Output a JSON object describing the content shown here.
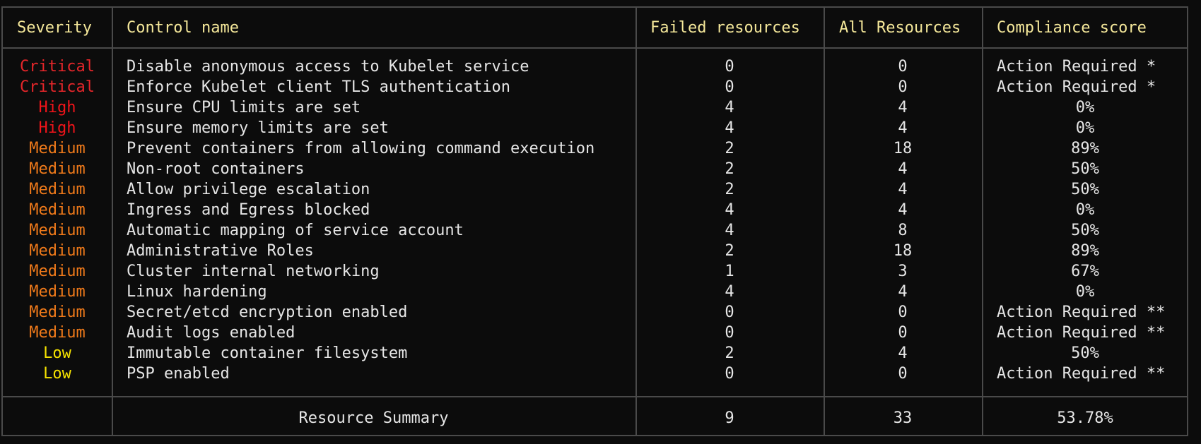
{
  "headers": {
    "severity": "Severity",
    "control_name": "Control name",
    "failed": "Failed resources",
    "all": "All Resources",
    "score": "Compliance score"
  },
  "colors": {
    "background": "#0c0c0c",
    "header_text": "#f5e89a",
    "critical": "#e5262a",
    "high": "#f2141a",
    "medium": "#f07a1a",
    "low": "#f6e300",
    "border": "#4a4a4a"
  },
  "rows": [
    {
      "severity": "Critical",
      "level": "crit",
      "name": "Disable anonymous access to Kubelet service",
      "failed": "0",
      "all": "0",
      "score": "Action Required *"
    },
    {
      "severity": "Critical",
      "level": "crit",
      "name": "Enforce Kubelet client TLS authentication",
      "failed": "0",
      "all": "0",
      "score": "Action Required *"
    },
    {
      "severity": "High",
      "level": "high",
      "name": "Ensure CPU limits are set",
      "failed": "4",
      "all": "4",
      "score": "0%"
    },
    {
      "severity": "High",
      "level": "high",
      "name": "Ensure memory limits are set",
      "failed": "4",
      "all": "4",
      "score": "0%"
    },
    {
      "severity": "Medium",
      "level": "med",
      "name": "Prevent containers from allowing command execution",
      "failed": "2",
      "all": "18",
      "score": "89%"
    },
    {
      "severity": "Medium",
      "level": "med",
      "name": "Non-root containers",
      "failed": "2",
      "all": "4",
      "score": "50%"
    },
    {
      "severity": "Medium",
      "level": "med",
      "name": "Allow privilege escalation",
      "failed": "2",
      "all": "4",
      "score": "50%"
    },
    {
      "severity": "Medium",
      "level": "med",
      "name": "Ingress and Egress blocked",
      "failed": "4",
      "all": "4",
      "score": "0%"
    },
    {
      "severity": "Medium",
      "level": "med",
      "name": "Automatic mapping of service account",
      "failed": "4",
      "all": "8",
      "score": "50%"
    },
    {
      "severity": "Medium",
      "level": "med",
      "name": "Administrative Roles",
      "failed": "2",
      "all": "18",
      "score": "89%"
    },
    {
      "severity": "Medium",
      "level": "med",
      "name": "Cluster internal networking",
      "failed": "1",
      "all": "3",
      "score": "67%"
    },
    {
      "severity": "Medium",
      "level": "med",
      "name": "Linux hardening",
      "failed": "4",
      "all": "4",
      "score": "0%"
    },
    {
      "severity": "Medium",
      "level": "med",
      "name": "Secret/etcd encryption enabled",
      "failed": "0",
      "all": "0",
      "score": "Action Required **"
    },
    {
      "severity": "Medium",
      "level": "med",
      "name": "Audit logs enabled",
      "failed": "0",
      "all": "0",
      "score": "Action Required **"
    },
    {
      "severity": "Low",
      "level": "low",
      "name": "Immutable container filesystem",
      "failed": "2",
      "all": "4",
      "score": "50%"
    },
    {
      "severity": "Low",
      "level": "low",
      "name": "PSP enabled",
      "failed": "0",
      "all": "0",
      "score": "Action Required **"
    }
  ],
  "summary": {
    "label": "Resource Summary",
    "failed": "9",
    "all": "33",
    "score": "53.78%"
  }
}
